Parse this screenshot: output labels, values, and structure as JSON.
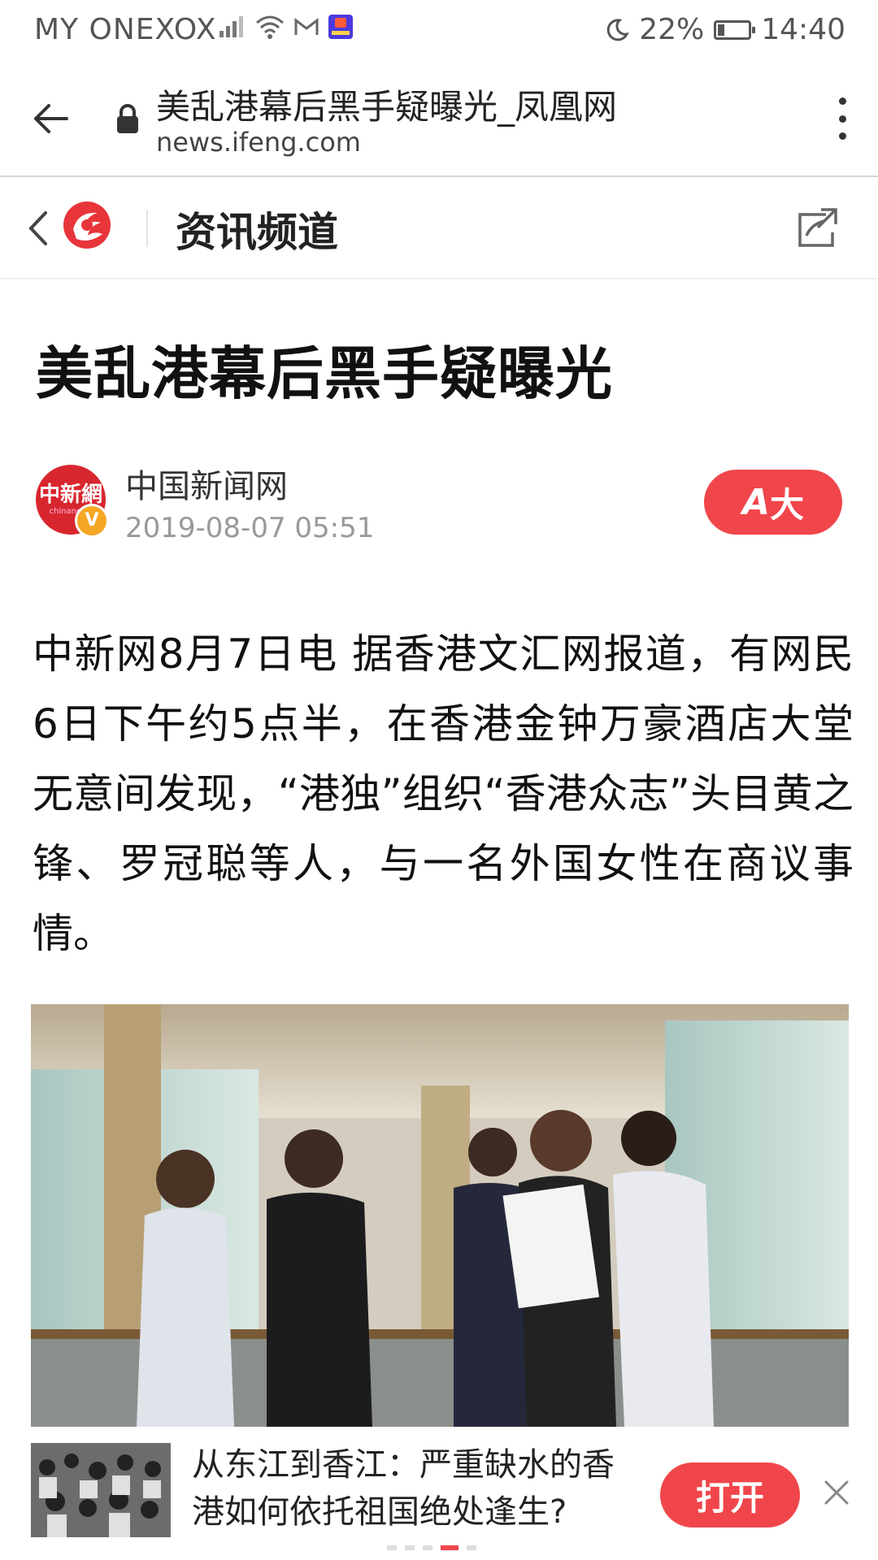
{
  "status_bar": {
    "carrier": "MY ONEXOX",
    "battery": "22%",
    "battery_level": 0.22,
    "time": "14:40"
  },
  "browser": {
    "page_title": "美乱港幕后黑手疑曝光_凤凰网",
    "domain": "news.ifeng.com"
  },
  "channel": {
    "title": "资讯频道"
  },
  "article": {
    "headline": "美乱港幕后黑手疑曝光",
    "source": "中国新闻网",
    "source_logo_text": "中新網",
    "source_logo_sub": "chinanews",
    "date": "2019-08-07 05:51",
    "font_button_label": "大",
    "font_button_icon": "A",
    "body": "中新网8月7日电 据香港文汇网报道，有网民6日下午约5点半，在香港金钟万豪酒店大堂无意间发现，“港独”组织“香港众志”头目黄之锋、罗冠聪等人，与一名外国女性在商议事情。"
  },
  "ad": {
    "text": "从东江到香江：严重缺水的香港如何依托祖国绝处逢生?",
    "open_label": "打开"
  },
  "colors": {
    "accent": "#f0464b",
    "brand_red": "#d8262f"
  }
}
